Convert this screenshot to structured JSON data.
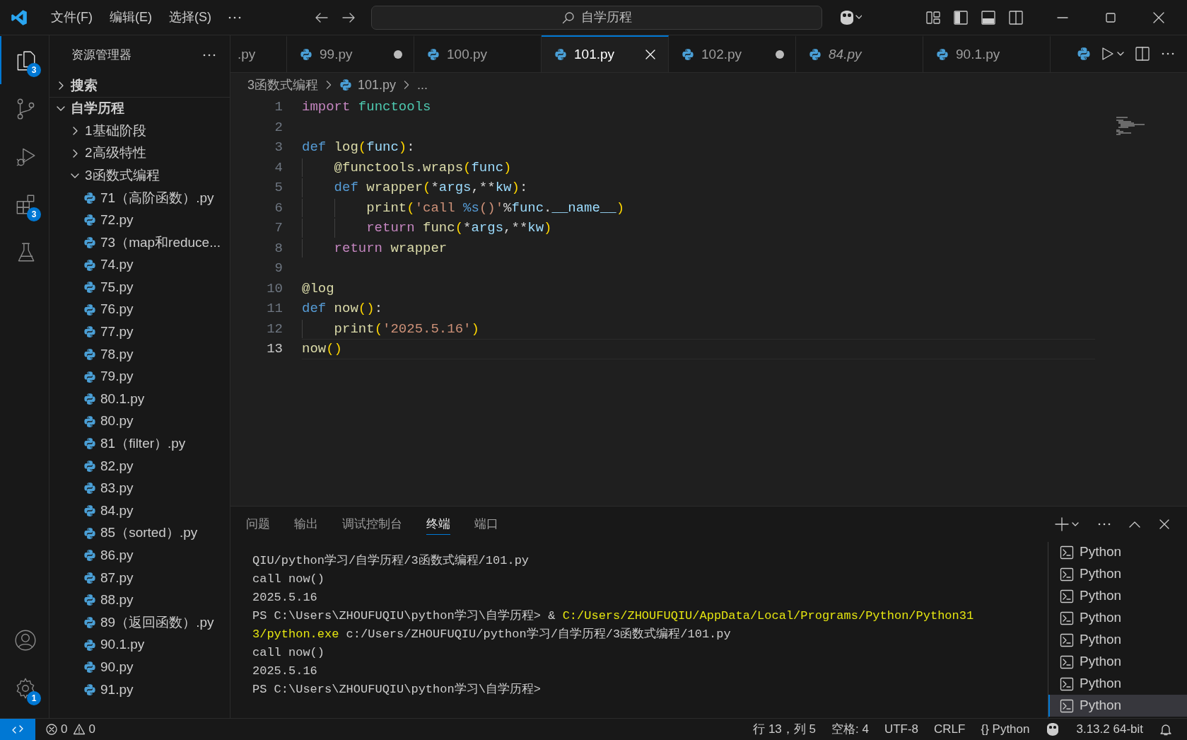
{
  "title_bar": {
    "menus": [
      "文件(F)",
      "编辑(E)",
      "选择(S)"
    ],
    "search": {
      "value": "自学历程"
    }
  },
  "activity_bar": {
    "top": [
      {
        "kind": "explorer",
        "selected": true,
        "badge": "3"
      },
      {
        "kind": "source-control",
        "selected": false
      },
      {
        "kind": "run-debug",
        "selected": false
      },
      {
        "kind": "extensions",
        "selected": false,
        "badge": "3"
      },
      {
        "kind": "testing",
        "selected": false
      }
    ],
    "bottom": [
      {
        "kind": "account"
      },
      {
        "kind": "settings",
        "badge": "1"
      }
    ]
  },
  "sidebar": {
    "title": "资源管理器",
    "tree": [
      {
        "label": "搜索",
        "kind": "folder",
        "expanded": false
      },
      {
        "label": "自学历程",
        "kind": "folder",
        "expanded": true,
        "children": [
          {
            "label": "1基础阶段",
            "kind": "folder",
            "expanded": false
          },
          {
            "label": "2高级特性",
            "kind": "folder",
            "expanded": false
          },
          {
            "label": "3函数式编程",
            "kind": "folder",
            "expanded": true,
            "children": [
              {
                "label": "71（高阶函数）.py",
                "kind": "python"
              },
              {
                "label": "72.py",
                "kind": "python"
              },
              {
                "label": "73（map和reduce...",
                "kind": "python"
              },
              {
                "label": "74.py",
                "kind": "python"
              },
              {
                "label": "75.py",
                "kind": "python"
              },
              {
                "label": "76.py",
                "kind": "python"
              },
              {
                "label": "77.py",
                "kind": "python"
              },
              {
                "label": "78.py",
                "kind": "python"
              },
              {
                "label": "79.py",
                "kind": "python"
              },
              {
                "label": "80.1.py",
                "kind": "python"
              },
              {
                "label": "80.py",
                "kind": "python"
              },
              {
                "label": "81（filter）.py",
                "kind": "python"
              },
              {
                "label": "82.py",
                "kind": "python"
              },
              {
                "label": "83.py",
                "kind": "python"
              },
              {
                "label": "84.py",
                "kind": "python"
              },
              {
                "label": "85（sorted）.py",
                "kind": "python"
              },
              {
                "label": "86.py",
                "kind": "python"
              },
              {
                "label": "87.py",
                "kind": "python"
              },
              {
                "label": "88.py",
                "kind": "python"
              },
              {
                "label": "89（返回函数）.py",
                "kind": "python"
              },
              {
                "label": "90.1.py",
                "kind": "python"
              },
              {
                "label": "90.py",
                "kind": "python"
              },
              {
                "label": "91.py",
                "kind": "python"
              }
            ]
          }
        ]
      }
    ]
  },
  "editor": {
    "tabs": [
      {
        "label": ".py",
        "selected": false,
        "modified": false,
        "preview": false,
        "icon": false
      },
      {
        "label": "99.py",
        "selected": false,
        "modified": true,
        "preview": false,
        "icon": true
      },
      {
        "label": "100.py",
        "selected": false,
        "modified": false,
        "preview": false,
        "icon": true
      },
      {
        "label": "101.py",
        "selected": true,
        "modified": false,
        "preview": false,
        "icon": true
      },
      {
        "label": "102.py",
        "selected": false,
        "modified": true,
        "preview": false,
        "icon": true
      },
      {
        "label": "84.py",
        "selected": false,
        "modified": false,
        "preview": true,
        "icon": true
      },
      {
        "label": "90.1.py",
        "selected": false,
        "modified": false,
        "preview": false,
        "icon": true
      }
    ],
    "breadcrumb": [
      {
        "label": "3函数式编程",
        "kind": "folder"
      },
      {
        "label": "101.py",
        "kind": "python"
      },
      {
        "label": "...",
        "kind": "symbol"
      }
    ],
    "lines": [
      {
        "number": "1",
        "current": false,
        "tokens": [
          {
            "t": "import",
            "kind": "control"
          },
          {
            "t": " functools",
            "kind": "module"
          }
        ]
      },
      {
        "number": "2",
        "current": false
      },
      {
        "number": "3",
        "current": false,
        "tokens": [
          {
            "t": "def",
            "kind": "keyword"
          },
          {
            "t": " log",
            "kind": "function"
          },
          {
            "t": "(",
            "kind": "bracket"
          },
          {
            "t": "func",
            "kind": "param"
          },
          {
            "t": ")",
            "kind": "bracket"
          },
          {
            "t": ":",
            "kind": "plain"
          }
        ]
      },
      {
        "number": "4",
        "current": false,
        "tokens": [
          {
            "t": "    @functools",
            "kind": "function"
          },
          {
            "t": ".",
            "kind": "plain"
          },
          {
            "t": "wraps",
            "kind": "function"
          },
          {
            "t": "(",
            "kind": "bracket"
          },
          {
            "t": "func",
            "kind": "param"
          },
          {
            "t": ")",
            "kind": "bracket"
          }
        ]
      },
      {
        "number": "5",
        "current": false,
        "tokens": [
          {
            "t": "    def",
            "kind": "keyword"
          },
          {
            "t": " wrapper",
            "kind": "function"
          },
          {
            "t": "(",
            "kind": "bracket"
          },
          {
            "t": "*",
            "kind": "plain"
          },
          {
            "t": "args",
            "kind": "param"
          },
          {
            "t": ",**",
            "kind": "plain"
          },
          {
            "t": "kw",
            "kind": "param"
          },
          {
            "t": ")",
            "kind": "bracket"
          },
          {
            "t": ":",
            "kind": "plain"
          }
        ]
      },
      {
        "number": "6",
        "current": false,
        "tokens": [
          {
            "t": "        print",
            "kind": "function"
          },
          {
            "t": "(",
            "kind": "bracket"
          },
          {
            "t": "'call ",
            "kind": "string"
          },
          {
            "t": "%s",
            "kind": "format"
          },
          {
            "t": "()'",
            "kind": "string"
          },
          {
            "t": "%",
            "kind": "plain"
          },
          {
            "t": "func",
            "kind": "param"
          },
          {
            "t": ".",
            "kind": "plain"
          },
          {
            "t": "__name__",
            "kind": "param"
          },
          {
            "t": ")",
            "kind": "bracket"
          }
        ]
      },
      {
        "number": "7",
        "current": false,
        "tokens": [
          {
            "t": "        return",
            "kind": "control"
          },
          {
            "t": " func",
            "kind": "function"
          },
          {
            "t": "(",
            "kind": "bracket"
          },
          {
            "t": "*",
            "kind": "plain"
          },
          {
            "t": "args",
            "kind": "param"
          },
          {
            "t": ",**",
            "kind": "plain"
          },
          {
            "t": "kw",
            "kind": "param"
          },
          {
            "t": ")",
            "kind": "bracket"
          }
        ]
      },
      {
        "number": "8",
        "current": false,
        "tokens": [
          {
            "t": "    return",
            "kind": "control"
          },
          {
            "t": " wrapper",
            "kind": "function"
          }
        ]
      },
      {
        "number": "9",
        "current": false
      },
      {
        "number": "10",
        "current": false,
        "tokens": [
          {
            "t": "@log",
            "kind": "function"
          }
        ]
      },
      {
        "number": "11",
        "current": false,
        "tokens": [
          {
            "t": "def",
            "kind": "keyword"
          },
          {
            "t": " now",
            "kind": "function"
          },
          {
            "t": "()",
            "kind": "bracket"
          },
          {
            "t": ":",
            "kind": "plain"
          }
        ]
      },
      {
        "number": "12",
        "current": false,
        "tokens": [
          {
            "t": "    print",
            "kind": "function"
          },
          {
            "t": "(",
            "kind": "bracket"
          },
          {
            "t": "'2025.5.16'",
            "kind": "string"
          },
          {
            "t": ")",
            "kind": "bracket"
          }
        ]
      },
      {
        "number": "13",
        "current": true,
        "tokens": [
          {
            "t": "now",
            "kind": "function"
          },
          {
            "t": "()",
            "kind": "bracket"
          }
        ]
      }
    ]
  },
  "panel": {
    "tabs": [
      {
        "label": "问题",
        "selected": false
      },
      {
        "label": "输出",
        "selected": false
      },
      {
        "label": "调试控制台",
        "selected": false
      },
      {
        "label": "终端",
        "selected": true
      },
      {
        "label": "端口",
        "selected": false
      }
    ],
    "terminal": [
      [
        {
          "t": "QIU/python学习/自学历程/3函数式编程/101.py",
          "kind": "plain"
        }
      ],
      [
        {
          "t": "call now()",
          "kind": "plain"
        }
      ],
      [
        {
          "t": "2025.5.16",
          "kind": "plain"
        }
      ],
      [
        {
          "t": "PS C:\\Users\\ZHOUFUQIU\\python学习\\自学历程> & ",
          "kind": "plain"
        },
        {
          "t": "C:/Users/ZHOUFUQIU/AppData/Local/Programs/Python/Python31",
          "kind": "path"
        }
      ],
      [
        {
          "t": "3/python.exe",
          "kind": "path"
        },
        {
          "t": " c:/Users/ZHOUFUQIU/python学习/自学历程/3函数式编程/101.py",
          "kind": "plain"
        }
      ],
      [
        {
          "t": "call now()",
          "kind": "plain"
        }
      ],
      [
        {
          "t": "2025.5.16",
          "kind": "plain"
        }
      ],
      [
        {
          "t": "PS C:\\Users\\ZHOUFUQIU\\python学习\\自学历程>",
          "kind": "plain"
        }
      ]
    ],
    "terminals": [
      {
        "label": "Python",
        "selected": false
      },
      {
        "label": "Python",
        "selected": false
      },
      {
        "label": "Python",
        "selected": false
      },
      {
        "label": "Python",
        "selected": false
      },
      {
        "label": "Python",
        "selected": false
      },
      {
        "label": "Python",
        "selected": false
      },
      {
        "label": "Python",
        "selected": false
      },
      {
        "label": "Python",
        "selected": true
      }
    ]
  },
  "status_bar": {
    "errors": "0",
    "warnings": "0",
    "items": [
      {
        "label": "行 13，列 5",
        "kind": "text"
      },
      {
        "label": "空格: 4",
        "kind": "text"
      },
      {
        "label": "UTF-8",
        "kind": "text"
      },
      {
        "label": "CRLF",
        "kind": "text"
      },
      {
        "label": "{} Python",
        "kind": "text"
      },
      {
        "kind": "copilot"
      },
      {
        "label": "3.13.2 64-bit",
        "kind": "text"
      },
      {
        "kind": "bell"
      }
    ]
  }
}
